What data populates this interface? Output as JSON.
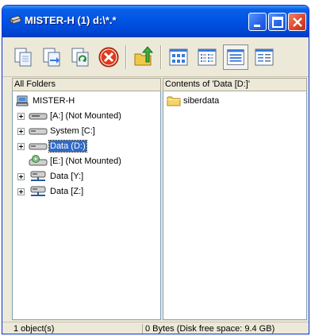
{
  "window": {
    "title": "MISTER-H (1) d:\\*.*"
  },
  "panes": {
    "left_header": "All Folders",
    "right_header": "Contents of 'Data [D:]'"
  },
  "tree": {
    "root": "MISTER-H",
    "drives": [
      {
        "label": "[A:] (Not Mounted)",
        "icon": "floppy-drive-icon"
      },
      {
        "label": "System [C:]",
        "icon": "hard-drive-icon"
      },
      {
        "label": "Data (D:)",
        "icon": "hard-drive-icon",
        "selected": true
      },
      {
        "label": "[E:] (Not Mounted)",
        "icon": "cd-drive-icon"
      },
      {
        "label": "Data [Y:]",
        "icon": "network-drive-icon"
      },
      {
        "label": "Data [Z:]",
        "icon": "network-drive-icon"
      }
    ]
  },
  "contents": {
    "items": [
      {
        "name": "siberdata",
        "icon": "folder-icon"
      }
    ]
  },
  "status": {
    "objects": "1 object(s)",
    "space": "0 Bytes (Disk free space: 9.4 GB)"
  },
  "toolbar": {
    "buttons": [
      "copy-icon",
      "move-icon",
      "refresh-icon",
      "delete-icon",
      "up-folder-icon",
      "large-icons-view-icon",
      "small-icons-view-icon",
      "list-view-icon",
      "details-view-icon"
    ]
  },
  "colors": {
    "titlebar": "#0055e5",
    "selection": "#316ac5",
    "close_button": "#e0462a"
  }
}
